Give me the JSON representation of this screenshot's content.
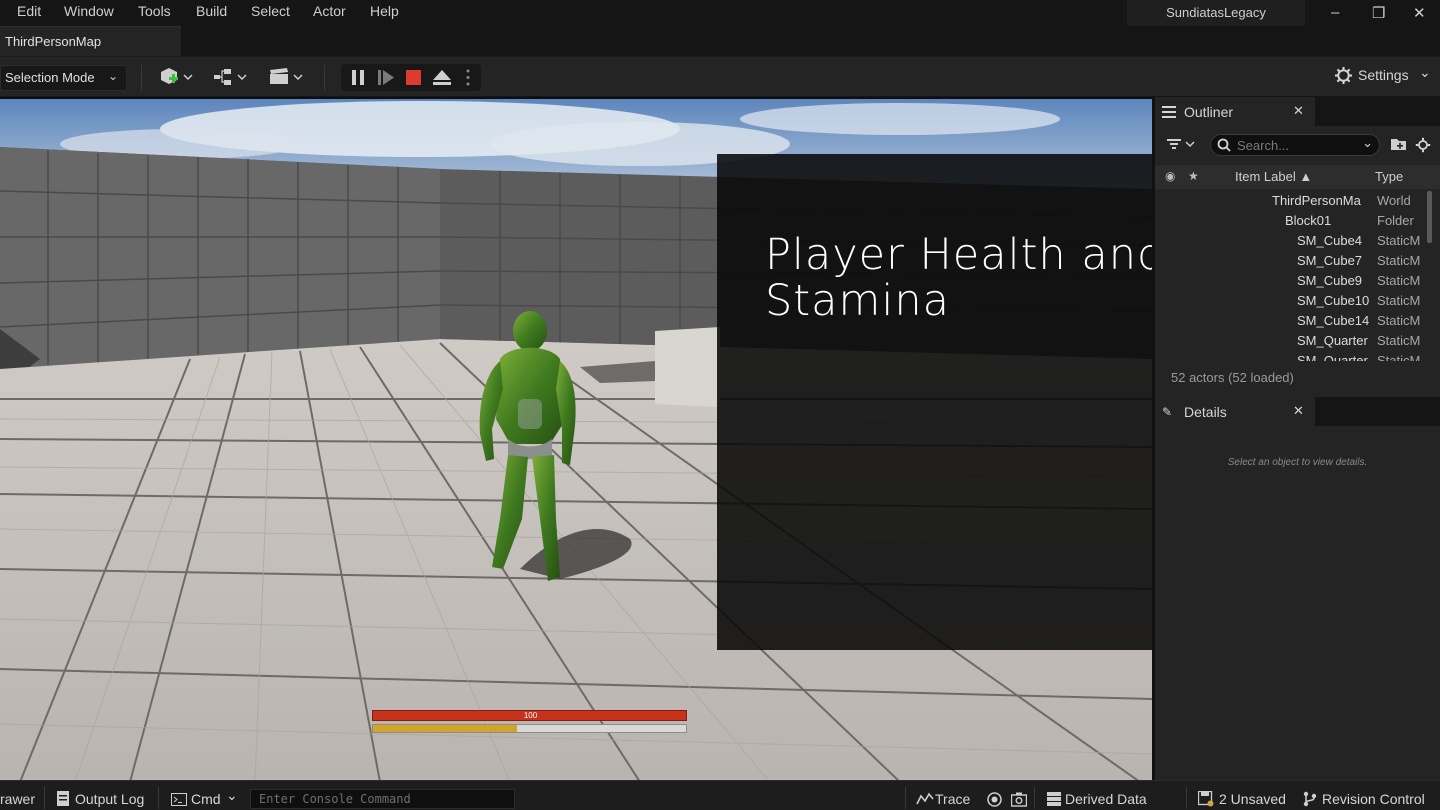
{
  "menu": {
    "items": [
      "Edit",
      "Window",
      "Tools",
      "Build",
      "Select",
      "Actor",
      "Help"
    ],
    "project_name": "SundiatasLegacy",
    "window_controls": {
      "minimize": "–",
      "restore": "❐",
      "close": "✕"
    }
  },
  "tabs": {
    "map_tab": "ThirdPersonMap"
  },
  "toolbar": {
    "selection_mode": "Selection Mode",
    "settings_label": "Settings",
    "icons": [
      "add-actor-icon",
      "blueprint-icon",
      "cinematics-icon",
      "pause-icon",
      "step-icon",
      "stop-icon",
      "eject-icon",
      "more-options-icon",
      "gear-icon"
    ],
    "stop_color": "#e03a30"
  },
  "overlay": {
    "title": "Player Health and Stamina"
  },
  "hud": {
    "health_value": "100",
    "health_color": "#c8311c",
    "stamina_fraction": 0.46,
    "stamina_color": "#d2a427"
  },
  "outliner": {
    "title": "Outliner",
    "search_placeholder": "Search...",
    "columns": {
      "label": "Item Label ▲",
      "type": "Type"
    },
    "rows": [
      {
        "label": "ThirdPersonMa",
        "type": "World"
      },
      {
        "label": "Block01",
        "type": "Folder"
      },
      {
        "label": "SM_Cube4",
        "type": "StaticM"
      },
      {
        "label": "SM_Cube7",
        "type": "StaticM"
      },
      {
        "label": "SM_Cube9",
        "type": "StaticM"
      },
      {
        "label": "SM_Cube10",
        "type": "StaticM"
      },
      {
        "label": "SM_Cube14",
        "type": "StaticM"
      },
      {
        "label": "SM_Quarter",
        "type": "StaticM"
      },
      {
        "label": "SM_Quarter",
        "type": "StaticM"
      }
    ],
    "actor_count": "52 actors (52 loaded)"
  },
  "details": {
    "title": "Details",
    "empty_message": "Select an object to view details."
  },
  "statusbar": {
    "drawer": "rawer",
    "output_log": "Output Log",
    "cmd": "Cmd",
    "console_placeholder": "Enter Console Command",
    "trace": "Trace",
    "derived_data": "Derived Data",
    "unsaved": "2 Unsaved",
    "revision_control": "Revision Control"
  }
}
